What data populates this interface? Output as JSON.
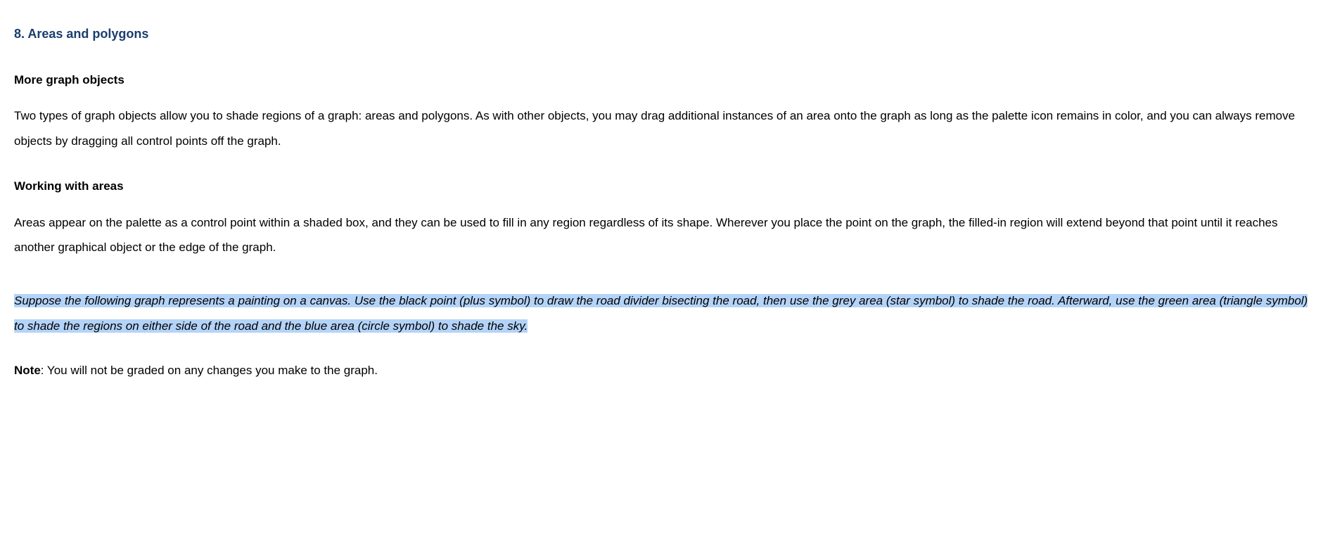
{
  "section": {
    "number_title": "8. Areas and polygons"
  },
  "subsection1": {
    "title": "More graph objects",
    "paragraph": "Two types of graph objects allow you to shade regions of a graph: areas and polygons. As with other objects, you may drag additional instances of an area onto the graph as long as the palette icon remains in color, and you can always remove objects by dragging all control points off the graph."
  },
  "subsection2": {
    "title": "Working with areas",
    "paragraph": "Areas appear on the palette as a control point within a shaded box, and they can be used to fill in any region regardless of its shape. Wherever you place the point on the graph, the filled-in region will extend beyond that point until it reaches another graphical object or the edge of the graph."
  },
  "instructions": {
    "text": "Suppose the following graph represents a painting on a canvas. Use the black point (plus symbol) to draw the road divider bisecting the road, then use the grey area (star symbol) to shade the road. Afterward, use the green area (triangle symbol) to shade the regions on either side of the road and the blue area (circle symbol) to shade the sky."
  },
  "note": {
    "label": "Note",
    "text": ": You will not be graded on any changes you make to the graph."
  }
}
